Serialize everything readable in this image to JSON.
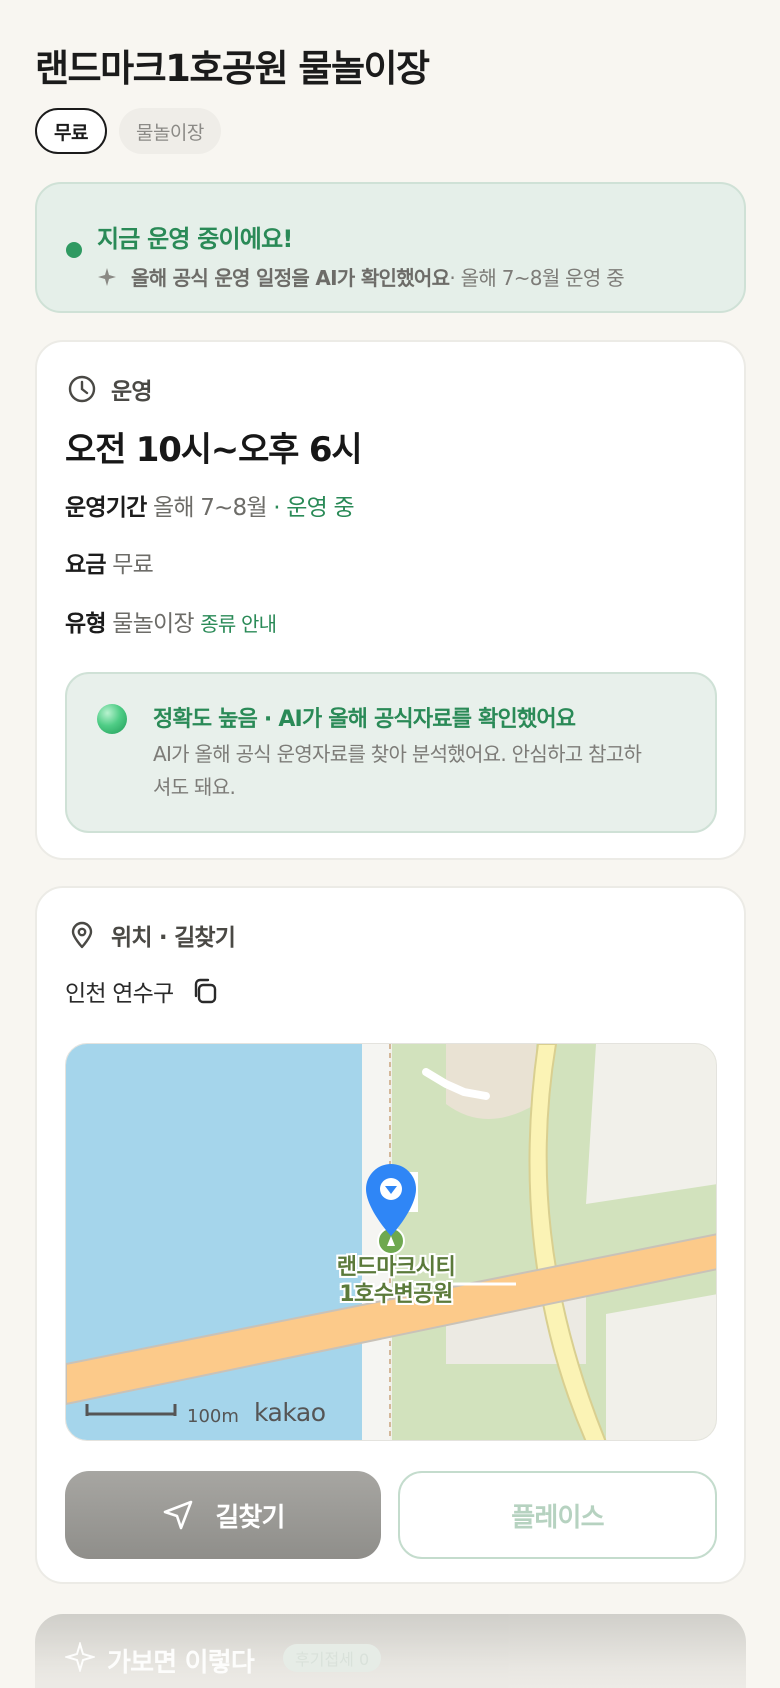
{
  "header": {
    "title": "랜드마크1호공원 물놀이장",
    "tags": [
      "무료",
      "물놀이장"
    ]
  },
  "status": {
    "title": "지금 운영 중이에요!",
    "sub_strong": "올해 공식 운영 일정을 AI가 확인했어요",
    "sub_rest": " · 올해 7~8월 운영 중",
    "icons": [
      "status-dot",
      "sparkle-icon"
    ],
    "color": "#2a8a57"
  },
  "operation": {
    "section_label": "운영",
    "hours": "오전 10시~오후 6시",
    "period_key": "운영기간",
    "period_value": "올해 7~8월",
    "period_status": " · 운영 중",
    "fee_key": "요금",
    "fee_value": "무료",
    "type_key": "유형",
    "type_value": "물놀이장",
    "type_link": "종류 안내",
    "accuracy": {
      "title": "정확도 높음 · AI가 올해 공식자료를 확인했어요",
      "desc": "AI가 올해 공식 운영자료를 찾아 분석했어요. 안심하고 참고하셔도 돼요."
    }
  },
  "location": {
    "section_label": "위치 · 길찾기",
    "address": "인천 연수구",
    "map": {
      "place_label_line1": "랜드마크시티",
      "place_label_line2": "1호수변공원",
      "scale": "100m",
      "provider": "kakao"
    },
    "route_button": "길찾기",
    "place_button": "플레이스"
  },
  "next_section": {
    "title": "가보면 이렇다",
    "badge": "후기접세 0"
  }
}
